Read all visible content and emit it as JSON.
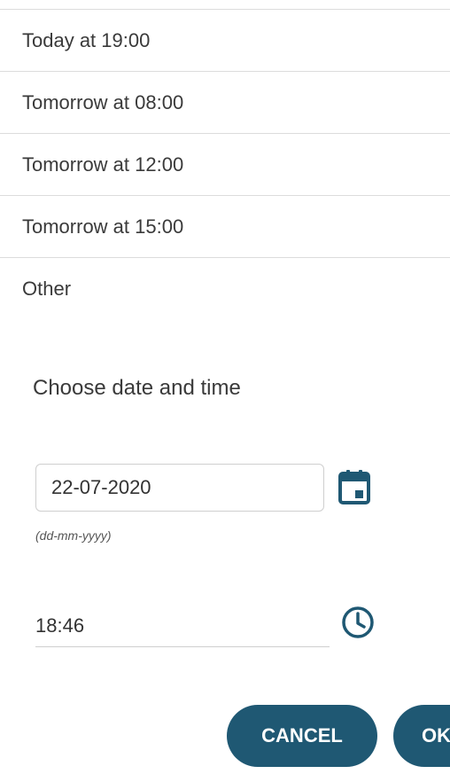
{
  "options": [
    {
      "label": "Today at 19:00"
    },
    {
      "label": "Tomorrow at 08:00"
    },
    {
      "label": "Tomorrow at 12:00"
    },
    {
      "label": "Tomorrow at 15:00"
    },
    {
      "label": "Other"
    }
  ],
  "picker": {
    "title": "Choose date and time",
    "date_value": "22-07-2020",
    "date_hint": "(dd-mm-yyyy)",
    "time_value": "18:46"
  },
  "buttons": {
    "cancel_label": "CANCEL",
    "ok_label": "OK"
  },
  "icons": {
    "calendar": "calendar-icon",
    "clock": "clock-icon"
  },
  "colors": {
    "accent": "#1f5873",
    "divider": "#dcdcdc"
  }
}
